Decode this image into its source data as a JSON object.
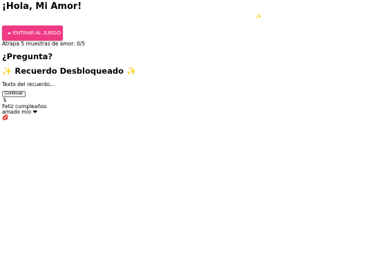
{
  "header": {
    "title": "¡Hola, Mi Amor!",
    "sparkle_icon": "sparkles-icon",
    "sparkle_glyph": "✨"
  },
  "game": {
    "enter_button_icon": "game-icon",
    "enter_button_label": "ENTRAR AL JUEGO",
    "enter_button_color": "#ee3a84",
    "catch_text": "Atrapa 5 muestras de amor: 0/5"
  },
  "question": {
    "title": "¿Pregunta?"
  },
  "memory": {
    "star_left": "✨",
    "title": "Recuerdo Desbloqueado",
    "star_right": "✨",
    "text": "Texto del recuerdo...",
    "continue_label": "Continuar"
  },
  "birthday": {
    "mic_icon": "microphone-icon",
    "line1": "Feliz cumpleaños",
    "line2": "amado mío ❤",
    "lips_icon": "kiss-icon",
    "lips_glyph": "💋"
  }
}
